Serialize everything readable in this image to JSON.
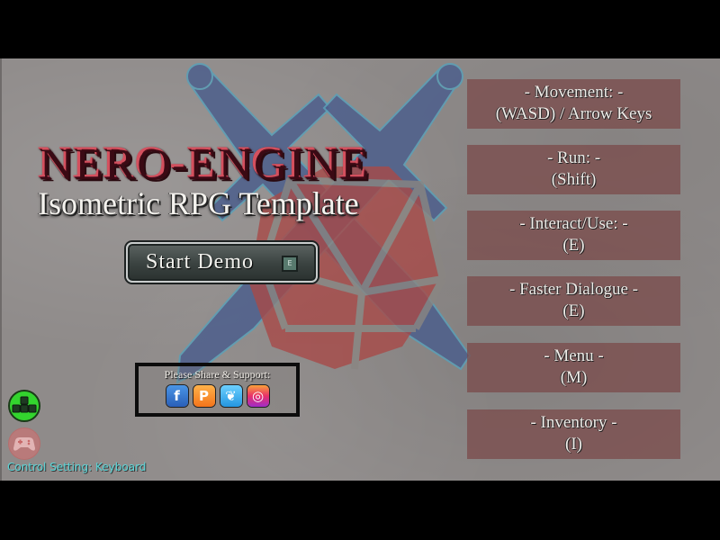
{
  "title": {
    "main": "NERO-ENGINE",
    "subtitle": "Isometric RPG Template"
  },
  "start_button": {
    "label": "Start Demo",
    "key_hint": "E"
  },
  "share": {
    "label": "Please Share & Support:",
    "icons": [
      {
        "name": "facebook-icon",
        "glyph": "f"
      },
      {
        "name": "patreon-icon",
        "glyph": "P"
      },
      {
        "name": "twitter-icon",
        "glyph": "❦"
      },
      {
        "name": "instagram-icon",
        "glyph": "◎"
      }
    ]
  },
  "control_setting": {
    "label": "Control Setting: Keyboard",
    "keyboard_keys": [
      "W",
      "A",
      "S",
      "D"
    ],
    "active": "keyboard"
  },
  "controls": [
    {
      "action": "- Movement: -",
      "keys": "(WASD) / Arrow Keys"
    },
    {
      "action": "- Run: -",
      "keys": "(Shift)"
    },
    {
      "action": "- Interact/Use: -",
      "keys": "(E)"
    },
    {
      "action": "- Faster Dialogue -",
      "keys": "(E)"
    },
    {
      "action": "- Menu -",
      "keys": "(M)"
    },
    {
      "action": "- Inventory -",
      "keys": "(I)"
    }
  ],
  "colors": {
    "title_red": "#a8162a",
    "panel": "#7a4848",
    "keyboard_active": "#33d42e",
    "control_label": "#5ad6d8"
  }
}
